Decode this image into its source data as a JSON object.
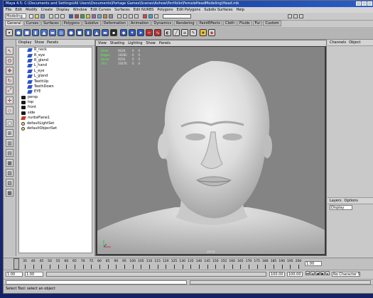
{
  "window": {
    "title": "Maya 4.5: C:\\Documents and Settings\\All Users\\Documents\\Portage Games\\Scenes\\Ashow\\Portfolio\\FemaleHeadModeling\\Head.mb"
  },
  "menubar": [
    "File",
    "Edit",
    "Modify",
    "Create",
    "Display",
    "Window",
    "Edit Curves",
    "Surfaces",
    "Edit NURBS",
    "Polygons",
    "Edit Polygons",
    "Subdiv Surfaces",
    "Help"
  ],
  "status_line": {
    "mode": "Modeling"
  },
  "shelf_tabs": [
    {
      "label": "General",
      "active": true
    },
    {
      "label": "Curves"
    },
    {
      "label": "Surfaces"
    },
    {
      "label": "Polygons"
    },
    {
      "label": "Subdivs"
    },
    {
      "label": "Deformation"
    },
    {
      "label": "Animation"
    },
    {
      "label": "Dynamics"
    },
    {
      "label": "Rendering"
    },
    {
      "label": "PaintEffects"
    },
    {
      "label": "Cloth"
    },
    {
      "label": "Fluids"
    },
    {
      "label": "Fur"
    },
    {
      "label": "Custom"
    }
  ],
  "outliner": {
    "menu": [
      "Display",
      "Show",
      "Panels"
    ],
    "items": [
      {
        "label": "R_neck",
        "icon": "joint-icon",
        "depth": 1
      },
      {
        "label": "R_eye",
        "icon": "joint-icon",
        "depth": 1
      },
      {
        "label": "R_gland",
        "icon": "joint-icon",
        "depth": 1
      },
      {
        "label": "L_hand",
        "icon": "joint-icon",
        "depth": 1
      },
      {
        "label": "L_eye",
        "icon": "joint-icon",
        "depth": 1
      },
      {
        "label": "L_gland",
        "icon": "joint-icon",
        "depth": 1
      },
      {
        "label": "TeethUp",
        "icon": "joint-icon",
        "depth": 1
      },
      {
        "label": "TeethDown",
        "icon": "joint-icon",
        "depth": 1
      },
      {
        "label": "EYE",
        "icon": "joint-icon",
        "depth": 1
      },
      {
        "label": "persp",
        "icon": "camera-icon",
        "depth": 0
      },
      {
        "label": "top",
        "icon": "camera-icon",
        "depth": 0
      },
      {
        "label": "front",
        "icon": "camera-icon",
        "depth": 0
      },
      {
        "label": "side",
        "icon": "camera-icon",
        "depth": 0
      },
      {
        "label": "nurbsPlane1",
        "icon": "mesh-icon",
        "depth": 0
      },
      {
        "label": "defaultLightSet",
        "icon": "set-icon",
        "depth": 0
      },
      {
        "label": "defaultObjectSet",
        "icon": "set-icon",
        "depth": 0
      }
    ]
  },
  "viewport": {
    "menu": [
      "View",
      "Shading",
      "Lighting",
      "Show",
      "Panels"
    ],
    "hud": [
      {
        "label": "Verts:",
        "v1": "9028",
        "v2": "0",
        "v3": "0"
      },
      {
        "label": "Edges:",
        "v1": "18282",
        "v2": "0",
        "v3": "0"
      },
      {
        "label": "Faces:",
        "v1": "9256",
        "v2": "0",
        "v3": "0"
      },
      {
        "label": "UVs:",
        "v1": "10476",
        "v2": "0",
        "v3": "0"
      }
    ],
    "camera": "persp"
  },
  "channel_box": {
    "menu": [
      "Channels",
      "Object"
    ]
  },
  "layer_editor": {
    "menu": [
      "Layers",
      "Options"
    ],
    "selected": "Display"
  },
  "time_slider": {
    "ticks": [
      "35",
      "40",
      "45",
      "50",
      "55",
      "60",
      "65",
      "70",
      "75",
      "80",
      "85",
      "90",
      "95",
      "100",
      "105",
      "110",
      "115",
      "120",
      "125",
      "130",
      "135",
      "140",
      "145",
      "150",
      "155",
      "160",
      "165",
      "170",
      "175",
      "180",
      "185",
      "190",
      "195",
      "200"
    ],
    "current_frame": "1.00"
  },
  "range": {
    "start": "1.00",
    "playback_start": "1.00",
    "playback_end": "100.00",
    "end": "100.00",
    "character_set": "No Character Set"
  },
  "help_line": "Select Tool: select an object",
  "colors": {
    "desktop": "#1d2f86",
    "panel": "#c9c9c9",
    "viewport_bg": "#848484",
    "hud_label": "#52ff52"
  }
}
